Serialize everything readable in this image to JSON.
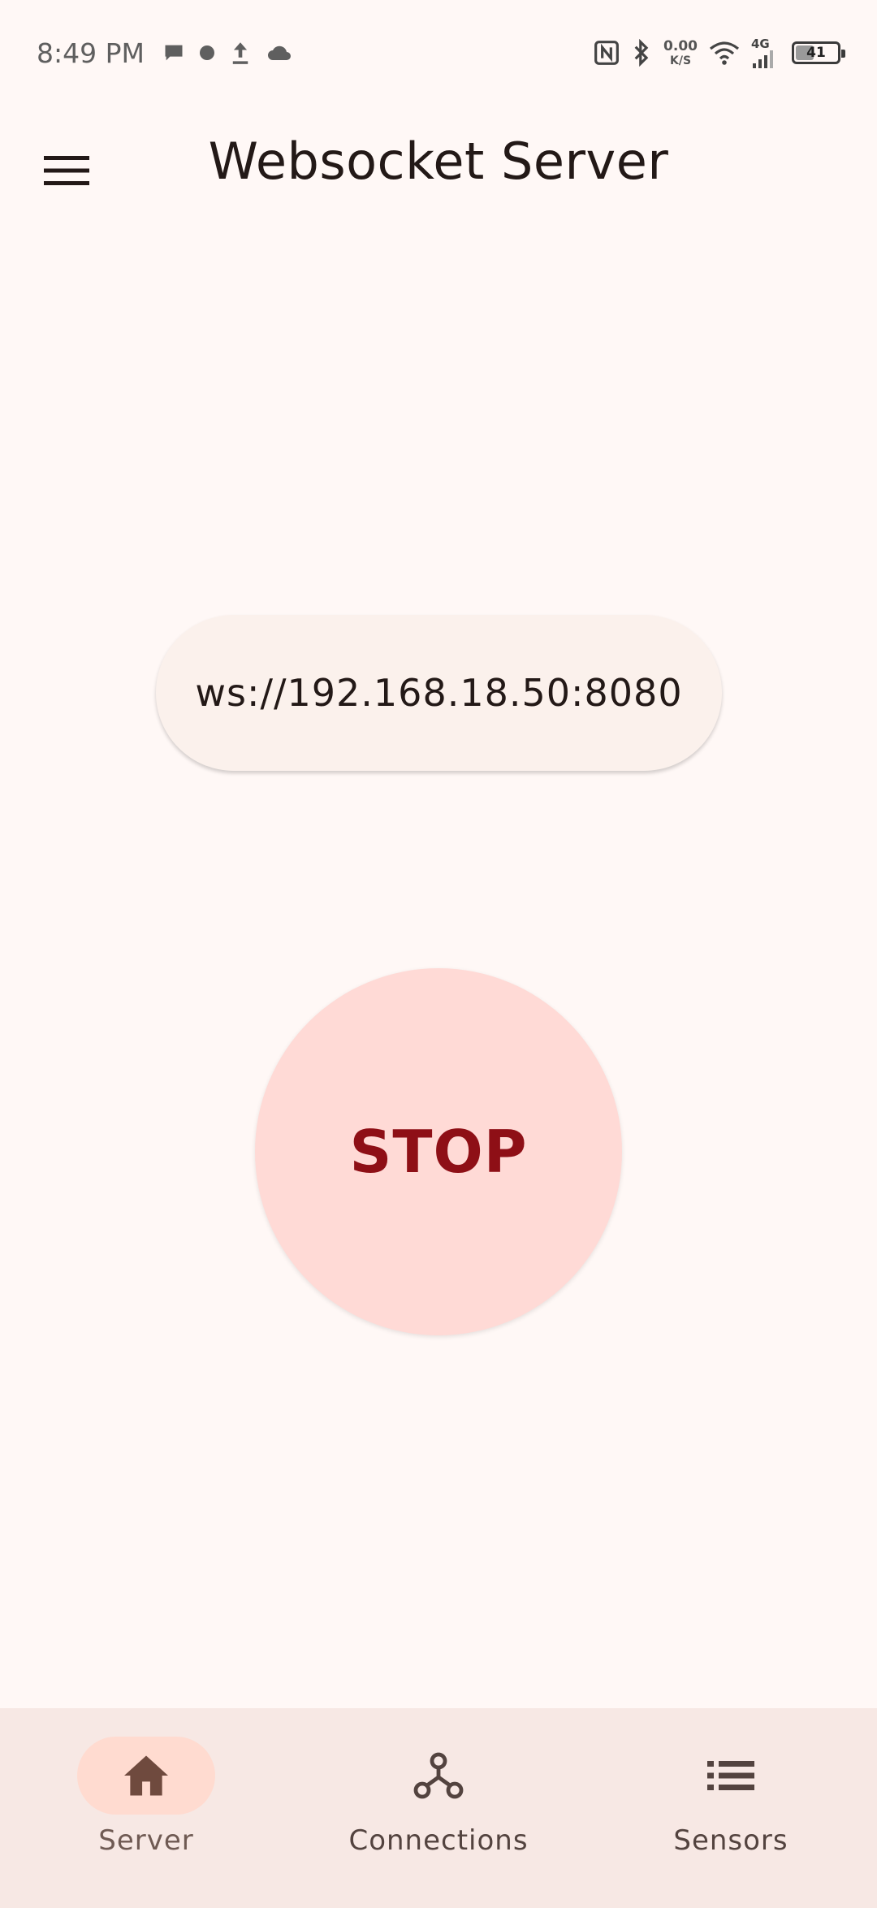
{
  "status_bar": {
    "time": "8:49 PM",
    "net_speed_value": "0.00",
    "net_speed_unit": "K/S",
    "network_type": "4G",
    "battery_level": "41"
  },
  "app_bar": {
    "title": "Websocket Server"
  },
  "server": {
    "url": "ws://192.168.18.50:8080",
    "stop_label": "STOP"
  },
  "bottom_nav": {
    "items": [
      {
        "label": "Server",
        "icon": "home-icon",
        "active": true
      },
      {
        "label": "Connections",
        "icon": "hub-icon",
        "active": false
      },
      {
        "label": "Sensors",
        "icon": "list-icon",
        "active": false
      }
    ]
  },
  "colors": {
    "background": "#FFF8F6",
    "chip": "#FBF1EC",
    "stop_bg": "#FFDAD6",
    "stop_text": "#8E0F16",
    "nav_bg": "#F7E8E4",
    "nav_active": "#FFDBD0"
  }
}
